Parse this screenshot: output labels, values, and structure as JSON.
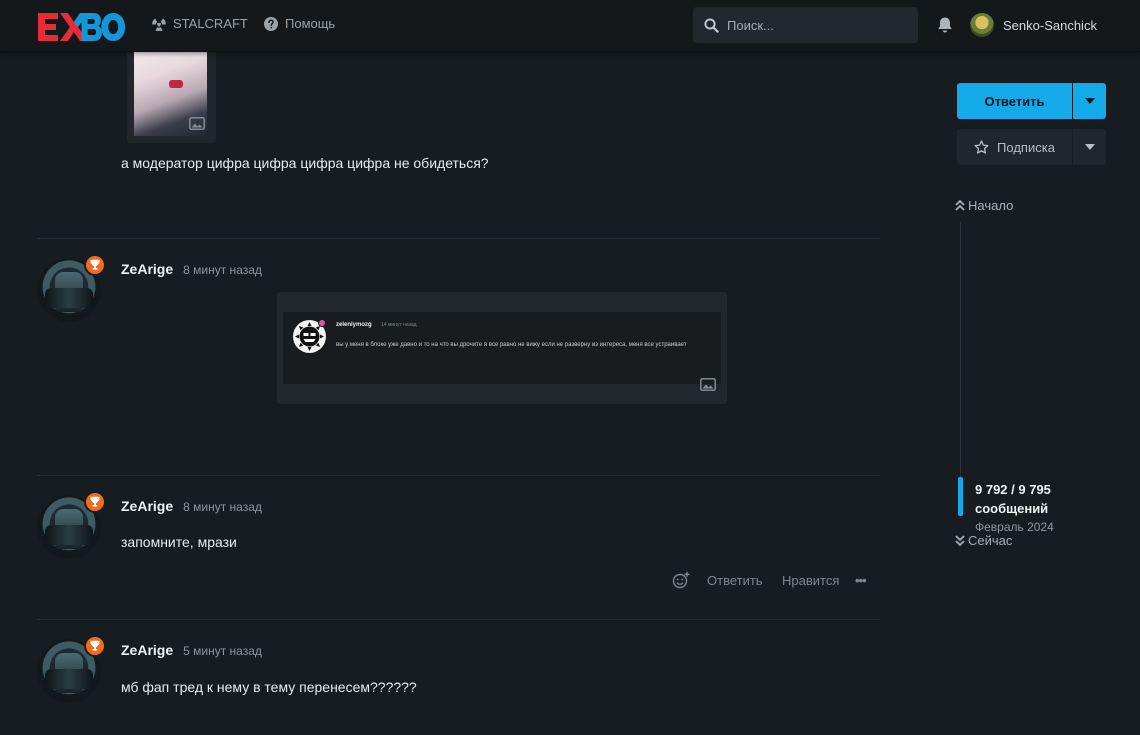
{
  "header": {
    "logo_text": "EXBO",
    "nav": [
      {
        "label": "STALCRAFT",
        "icon": "radiation-icon"
      },
      {
        "label": "Помощь",
        "icon": "help-circle-icon"
      }
    ],
    "search": {
      "placeholder": "Поиск..."
    },
    "user": {
      "name": "Senko-Sanchick"
    }
  },
  "posts": [
    {
      "text": "а модератор цифра цифра цифра цифра не обидеться?"
    },
    {
      "author": "ZeArige",
      "time": "8 минут назад",
      "quote": {
        "author": "zeleniymozg",
        "time": "14 минут назад",
        "text": "вы у меня в блоке уже давно и то на что вы дрочите я все равно не вижу если не разверну из интереса, меня все устраивает"
      }
    },
    {
      "author": "ZeArige",
      "time": "8 минут назад",
      "text": "запомните, мрази",
      "actions": {
        "reply": "Ответить",
        "like": "Нравится",
        "more": "•••"
      }
    },
    {
      "author": "ZeArige",
      "time": "5 минут назад",
      "text": "мб фап тред к нему в тему перенесем??????"
    }
  ],
  "sidebar": {
    "reply_label": "Ответить",
    "subscribe_label": "Подписка",
    "scroll": {
      "start_label": "Начало",
      "count_line1": "9 792 / 9 795",
      "count_line2": "сообщений",
      "date": "Февраль 2024",
      "now_label": "Сейчас",
      "position_fraction": 0.9997
    }
  },
  "colors": {
    "accent": "#14a9e8",
    "badge": "#f26a1b",
    "logo_red": "#e52d3a",
    "logo_blue": "#1596d8"
  }
}
